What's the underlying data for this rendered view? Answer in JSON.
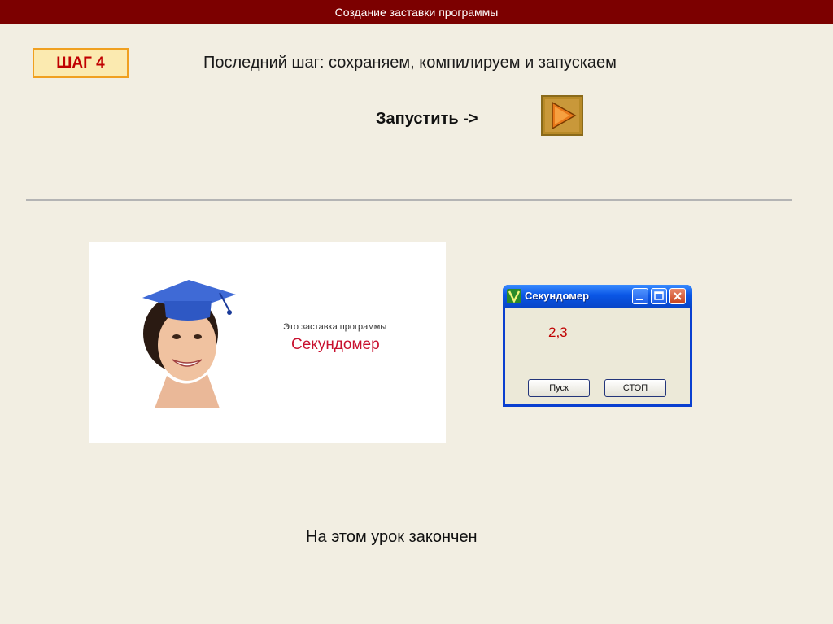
{
  "header": {
    "title": "Создание заставки программы"
  },
  "step": {
    "badge": "ШАГ 4",
    "description": "Последний шаг: сохраняем, компилируем и запускаем"
  },
  "run": {
    "label": "Запустить ->",
    "button_icon": "play-arrow-icon"
  },
  "splash": {
    "caption": "Это заставка программы",
    "title": "Секундомер"
  },
  "app_window": {
    "title": "Секундомер",
    "value": "2,3",
    "start_button": "Пуск",
    "stop_button": "СТОП"
  },
  "footer": {
    "text": "На этом урок закончен"
  },
  "colors": {
    "header_bg": "#7c0000",
    "page_bg": "#f2eee2",
    "badge_text": "#c00000",
    "badge_border": "#f0a020",
    "accent_red": "#c8102e"
  }
}
